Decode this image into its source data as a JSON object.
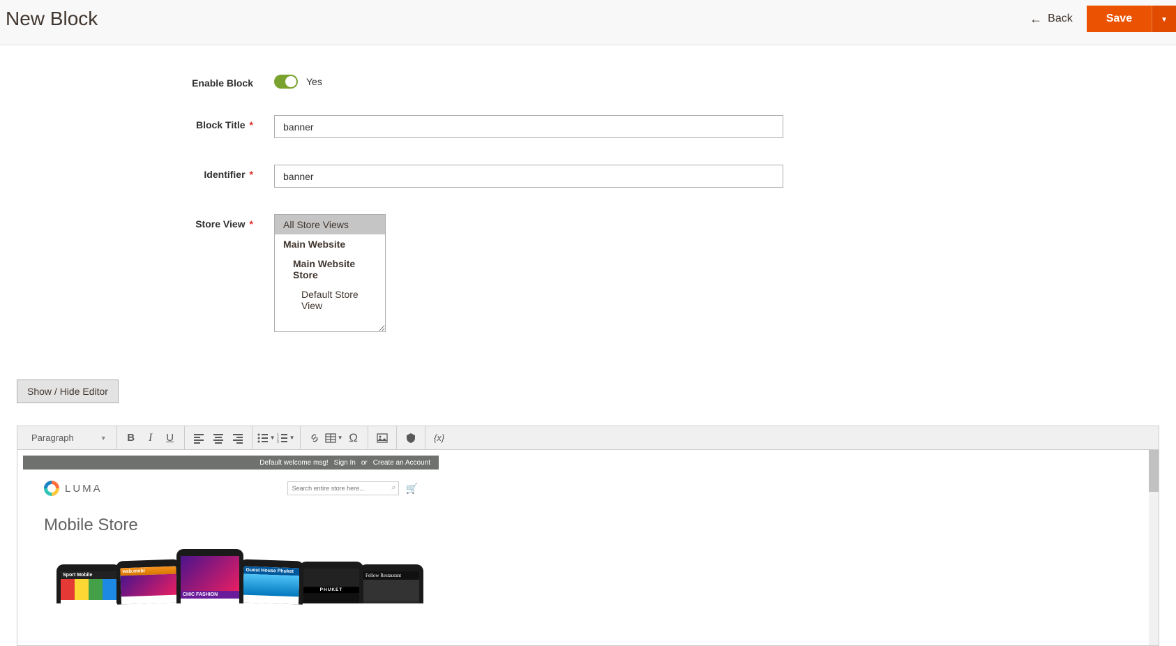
{
  "header": {
    "title": "New Block",
    "back_label": "Back",
    "save_label": "Save"
  },
  "form": {
    "enable_block": {
      "label": "Enable Block",
      "value_text": "Yes"
    },
    "block_title": {
      "label": "Block Title",
      "value": "banner"
    },
    "identifier": {
      "label": "Identifier",
      "value": "banner"
    },
    "store_view": {
      "label": "Store View",
      "options": [
        {
          "label": "All Store Views",
          "selected": true,
          "indent": 0,
          "bold": false
        },
        {
          "label": "Main Website",
          "selected": false,
          "indent": 0,
          "bold": true
        },
        {
          "label": "Main Website Store",
          "selected": false,
          "indent": 1,
          "bold": true
        },
        {
          "label": "Default Store View",
          "selected": false,
          "indent": 2,
          "bold": false
        }
      ]
    }
  },
  "editor": {
    "show_hide_label": "Show / Hide Editor",
    "format_label": "Paragraph",
    "variable_label": "{x}"
  },
  "preview": {
    "topbar": {
      "welcome": "Default welcome msg!",
      "signin": "Sign In",
      "or": "or",
      "create": "Create an Account"
    },
    "logo_text": "LUMA",
    "search_placeholder": "Search entire store here...",
    "content_title": "Mobile Store",
    "phones": [
      {
        "head": "Sport Mobile",
        "style": "stripes"
      },
      {
        "head": "web.mobi",
        "style": "orange"
      },
      {
        "head": "CHIC FASHION",
        "style": "purple"
      },
      {
        "head": "Guest House Phuket",
        "style": "blue",
        "label": "PHUKET"
      },
      {
        "head": "",
        "style": "dark",
        "label": "PHUKET"
      },
      {
        "head": "Fellow Restaurant",
        "style": "script"
      }
    ]
  }
}
